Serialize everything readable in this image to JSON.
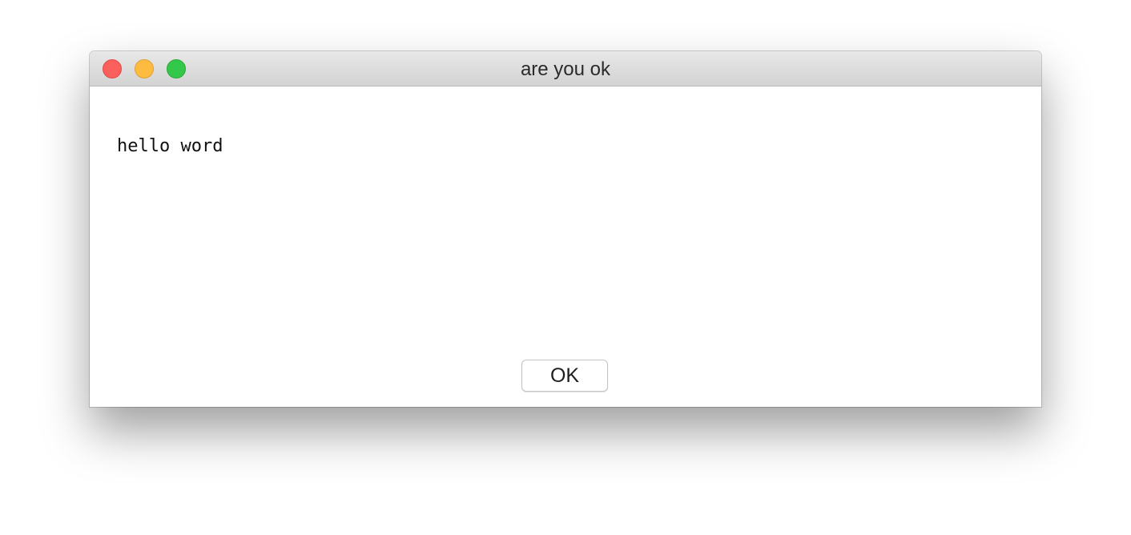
{
  "window": {
    "title": "are you ok",
    "controls": {
      "close": {
        "icon": "close-dot-icon",
        "color": "#fc605c"
      },
      "minimize": {
        "icon": "minimize-dot-icon",
        "color": "#fdbc40"
      },
      "zoom": {
        "icon": "zoom-dot-icon",
        "color": "#34c84a"
      }
    }
  },
  "dialog": {
    "message": "hello word",
    "ok_label": "OK"
  }
}
